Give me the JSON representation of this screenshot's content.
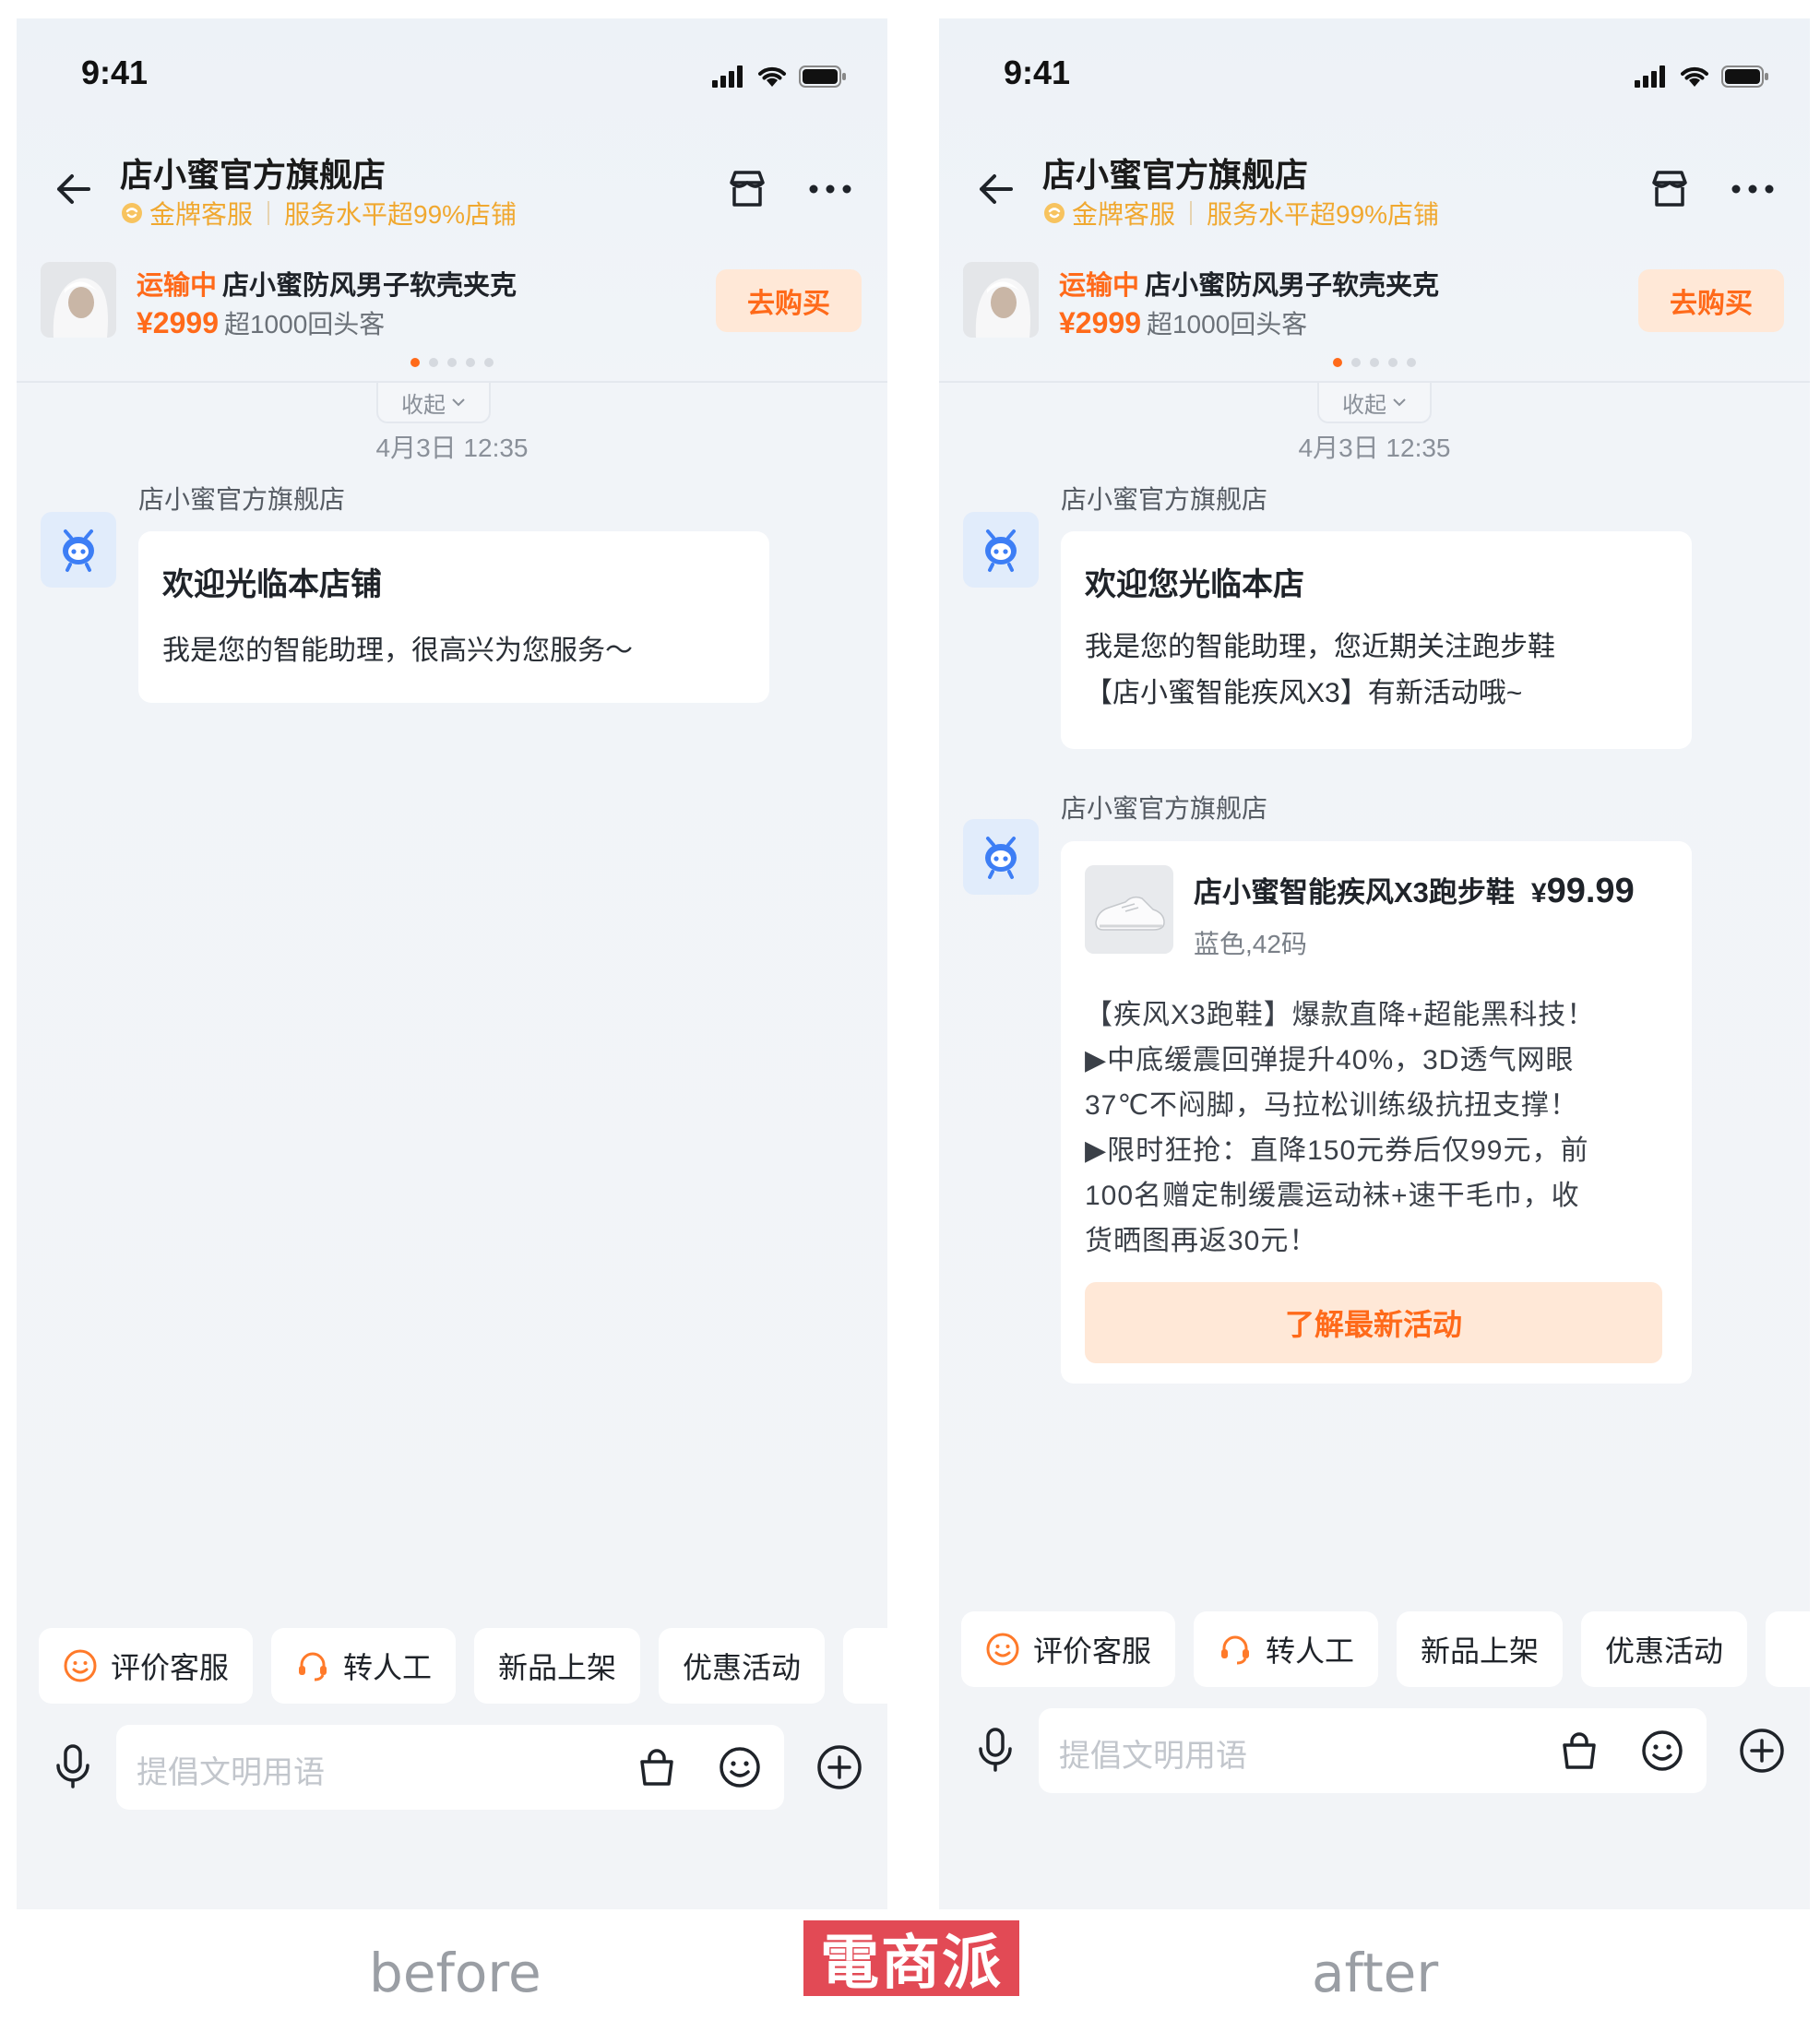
{
  "status_time": "9:41",
  "shop": {
    "name": "店小蜜官方旗舰店",
    "badge": "金牌客服",
    "service_level": "服务水平超99%店铺"
  },
  "product_bar": {
    "status": "运输中",
    "name": "店小蜜防风男子软壳夹克",
    "price": "¥2999",
    "repeat": "超1000回头客",
    "buy_label": "去购买"
  },
  "collapse_label": "收起",
  "timestamp": "4月3日 12:35",
  "sender_name": "店小蜜官方旗舰店",
  "before": {
    "welcome_title": "欢迎光临本店铺",
    "welcome_text": "我是您的智能助理，很高兴为您服务～"
  },
  "after": {
    "welcome_title": "欢迎您光临本店",
    "welcome_line1": "我是您的智能助理，您近期关注跑步鞋",
    "welcome_line2": "【店小蜜智能疾风X3】有新活动哦~",
    "promo": {
      "name": "店小蜜智能疾风X3跑步鞋",
      "price_prefix": "¥",
      "price_value": "99.99",
      "spec": "蓝色,42码",
      "desc_lines": [
        "【疾风X3跑鞋】爆款直降+超能黑科技！",
        "▶中底缓震回弹提升40%，3D透气网眼",
        "37℃不闷脚，马拉松训练级抗扭支撑！",
        "▶限时狂抢：直降150元券后仅99元，前",
        "100名赠定制缓震运动袜+速干毛巾，收",
        "货晒图再返30元！"
      ],
      "button": "了解最新活动"
    }
  },
  "quick_replies": {
    "rate": "评价客服",
    "human": "转人工",
    "new": "新品上架",
    "promo": "优惠活动"
  },
  "input_placeholder": "提倡文明用语",
  "captions": {
    "before": "before",
    "after": "after"
  },
  "logo_text": "電商派",
  "colors": {
    "accent": "#ff6a1a",
    "accent_bg": "#ffe8d7",
    "gold": "#f0a830",
    "bot_blue": "#3d7ef5"
  },
  "icons": [
    "back-arrow-icon",
    "store-icon",
    "more-icon",
    "bot-avatar-icon",
    "smile-icon",
    "headset-icon",
    "mic-icon",
    "bag-icon",
    "emoji-icon",
    "plus-icon",
    "signal-icon",
    "wifi-icon",
    "battery-icon"
  ]
}
